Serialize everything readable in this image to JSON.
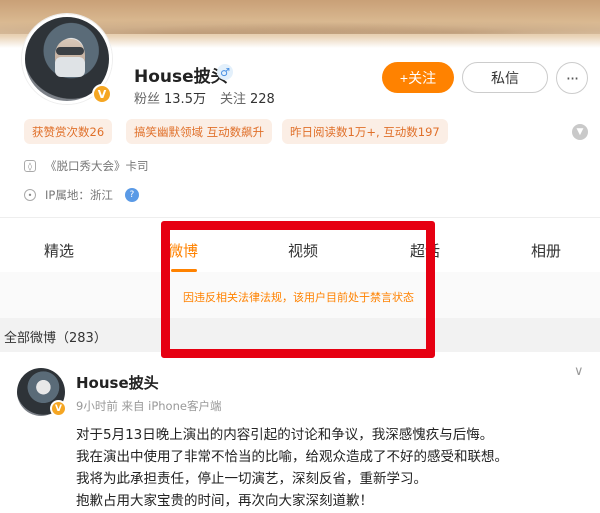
{
  "profile": {
    "name": "House披头",
    "verified_badge": "V",
    "gender_symbol": "♂",
    "followers_label": "粉丝",
    "followers_value": "13.5万",
    "following_label": "关注",
    "following_value": "228"
  },
  "actions": {
    "follow_label": "+关注",
    "message_label": "私信",
    "more_label": "···"
  },
  "tags": [
    "获赞赏次数26",
    "搞笑幽默领域 互动数飙升",
    "昨日阅读数1万+, 互动数197"
  ],
  "info": {
    "card_text": "《脱口秀大会》卡司",
    "ip_text": "IP属地：浙江",
    "help_symbol": "?"
  },
  "tabs": [
    "精选",
    "微博",
    "视频",
    "超话",
    "相册"
  ],
  "active_tab": "微博",
  "notice": "因违反相关法律法规，该用户目前处于禁言状态",
  "section_title": "全部微博（283）",
  "post": {
    "author": "House披头",
    "meta": "9小时前  来自 iPhone客户端",
    "lines": [
      "对于5月13日晚上演出的内容引起的讨论和争议，我深感愧疚与后悔。",
      "我在演出中使用了非常不恰当的比喻，给观众造成了不好的感受和联想。",
      "我将为此承担责任，停止一切演艺，深刻反省，重新学习。",
      "抱歉占用大家宝贵的时间，再次向大家深刻道歉！"
    ]
  },
  "colors": {
    "accent": "#ff8200",
    "highlight_box": "#e60012",
    "tag_bg": "#fbeee5"
  }
}
